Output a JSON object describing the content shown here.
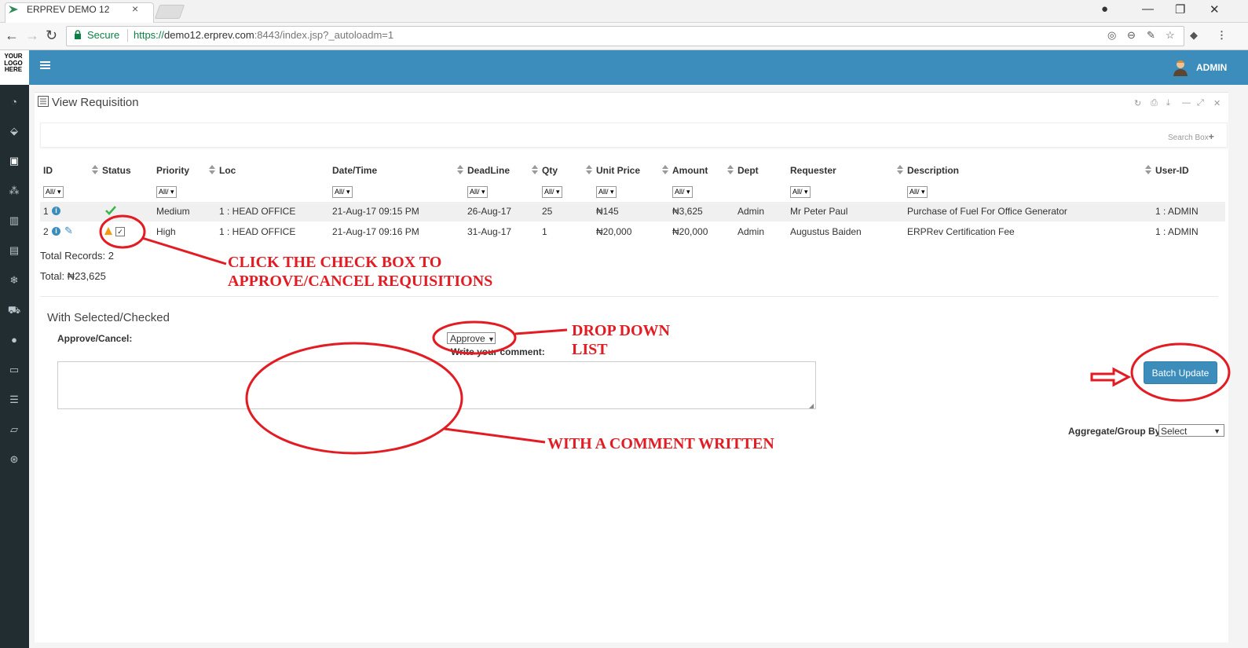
{
  "browser": {
    "tab_title": "ERPREV DEMO 12",
    "secure_label": "Secure",
    "url_proto": "https://",
    "url_host": "demo12.erprev.com",
    "url_rest": ":8443/index.jsp?_autoloadm=1"
  },
  "app": {
    "logo_lines": [
      "YOUR",
      "LOGO",
      "HERE"
    ],
    "user_label": "ADMIN",
    "panel_title": "View Requisition",
    "search_box_label": "Search Box"
  },
  "table": {
    "columns": [
      "ID",
      "Status",
      "Priority",
      "Loc",
      "Date/Time",
      "DeadLine",
      "Qty",
      "Unit Price",
      "Amount",
      "Dept",
      "Requester",
      "Description",
      "User-ID"
    ],
    "filter_value": "All/",
    "rows": [
      {
        "id": "1",
        "priority": "Medium",
        "loc": "1 : HEAD OFFICE",
        "datetime": "21-Aug-17 09:15 PM",
        "deadline": "26-Aug-17",
        "qty": "25",
        "unit_price": "₦145",
        "amount": "₦3,625",
        "dept": "Admin",
        "requester": "Mr Peter Paul",
        "description": "Purchase of Fuel For Office Generator",
        "user_id": "1 : ADMIN"
      },
      {
        "id": "2",
        "priority": "High",
        "loc": "1 : HEAD OFFICE",
        "datetime": "21-Aug-17 09:16 PM",
        "deadline": "31-Aug-17",
        "qty": "1",
        "unit_price": "₦20,000",
        "amount": "₦20,000",
        "dept": "Admin",
        "requester": "Augustus Baiden",
        "description": "ERPRev Certification Fee",
        "user_id": "1 : ADMIN"
      }
    ],
    "total_records": "Total Records: 2",
    "total_amount": "Total: ₦23,625"
  },
  "batch": {
    "with_selected": "With Selected/Checked",
    "approve_label": "Approve/Cancel:",
    "approve_value": "Approve",
    "comment_label": "Write your comment:",
    "batch_button": "Batch Update",
    "aggregate_label": "Aggregate/Group By:",
    "aggregate_value": "Select"
  },
  "annotations": {
    "checkbox_note_1": "CLICK THE CHECK BOX TO",
    "checkbox_note_2": "APPROVE/CANCEL REQUISITIONS",
    "dropdown_note_1": "DROP DOWN",
    "dropdown_note_2": "LIST",
    "comment_note": "WITH A COMMENT WRITTEN"
  },
  "colors": {
    "header": "#3c8dbc",
    "sidebar": "#222d32",
    "annotation": "#e31b23"
  }
}
